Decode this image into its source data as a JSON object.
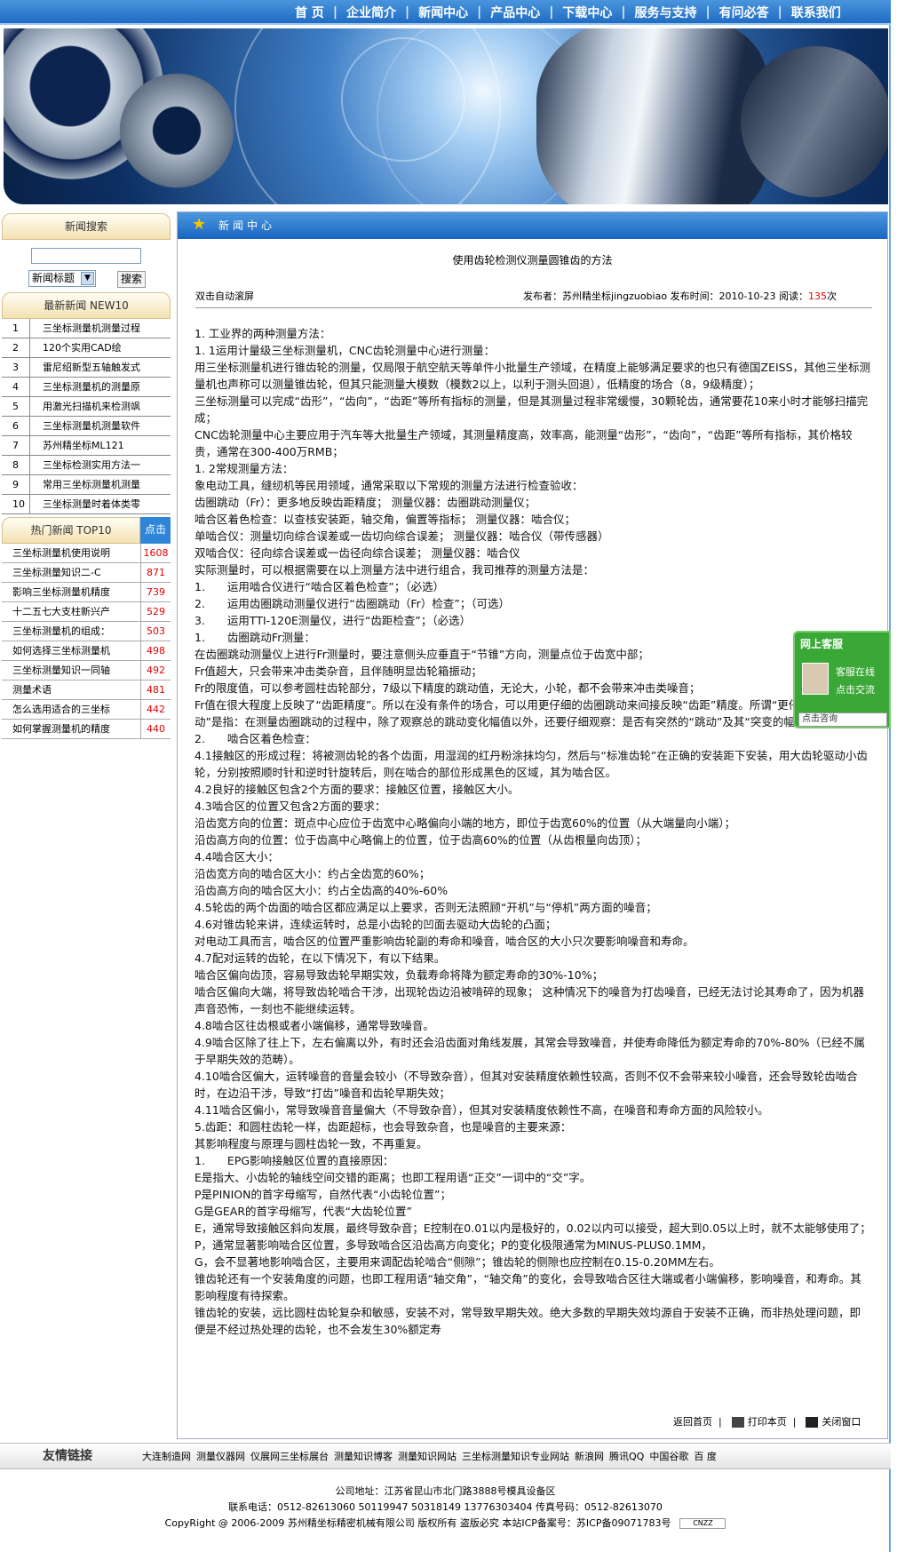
{
  "nav": [
    "首 页",
    "企业简介",
    "新闻中心",
    "产品中心",
    "下载中心",
    "服务与支持",
    "有问必答",
    "联系我们"
  ],
  "search": {
    "head": "新闻搜索",
    "select": "新闻标题",
    "button": "搜索"
  },
  "latest": {
    "head": "最新新闻 NEW10",
    "items": [
      {
        "n": "1",
        "t": "三坐标测量机测量过程"
      },
      {
        "n": "2",
        "t": "120个实用CAD绘"
      },
      {
        "n": "3",
        "t": "雷尼绍新型五轴触发式"
      },
      {
        "n": "4",
        "t": "三坐标测量机的测量原"
      },
      {
        "n": "5",
        "t": "用激光扫描机来检测飒"
      },
      {
        "n": "6",
        "t": "三坐标测量机测量软件"
      },
      {
        "n": "7",
        "t": "苏州精坐标ML121"
      },
      {
        "n": "8",
        "t": "三坐标检测实用方法一"
      },
      {
        "n": "9",
        "t": "常用三坐标测量机测量"
      },
      {
        "n": "10",
        "t": "三坐标测量时着体类零"
      }
    ]
  },
  "hot": {
    "head": "热门新闻 TOP10",
    "click": "点击",
    "items": [
      {
        "t": "三坐标测量机使用说明",
        "c": "1608"
      },
      {
        "t": "三坐标测量知识二-C",
        "c": "871"
      },
      {
        "t": "影响三坐标测量机精度",
        "c": "739"
      },
      {
        "t": "十二五七大支柱新兴产",
        "c": "529"
      },
      {
        "t": "三坐标测量机的组成：",
        "c": "503"
      },
      {
        "t": "如何选择三坐标测量机",
        "c": "498"
      },
      {
        "t": "三坐标测量知识一同轴",
        "c": "492"
      },
      {
        "t": "测量术语",
        "c": "481"
      },
      {
        "t": "怎么选用适合的三坐标",
        "c": "442"
      },
      {
        "t": "如何掌握测量机的精度",
        "c": "440"
      }
    ]
  },
  "main": {
    "head": "新闻中心",
    "title": "使用齿轮检测仪测量圆锥齿的方法",
    "scroll": "双击自动滚屏",
    "meta_pre": "发布者：苏州精坐标jingzuobiao 发布时间：2010-10-23 阅读：",
    "views": "135",
    "meta_post": "次",
    "paragraphs": [
      "1. 工业界的两种测量方法：",
      "1. 1运用计量级三坐标测量机，CNC齿轮测量中心进行测量：",
      "用三坐标测量机进行锥齿轮的测量，仅局限于航空航天等单件小批量生产领域，在精度上能够满足要求的也只有德国ZEISS，其他三坐标测量机也声称可以测量锥齿轮，但其只能测量大模数（模数2以上，以利于测头回退），低精度的场合（8，9级精度）；",
      "三坐标测量可以完成“齿形”，“齿向”，“齿距”等所有指标的测量，但是其测量过程非常缓慢，30颗轮齿，通常要花10来小时才能够扫描完成；",
      "CNC齿轮测量中心主要应用于汽车等大批量生产领域，其测量精度高，效率高，能测量“齿形”，“齿向”，“齿距”等所有指标，其价格较贵，通常在300-400万RMB；",
      "1. 2常规测量方法：",
      "象电动工具，缝纫机等民用领域，通常采取以下常规的测量方法进行检查验收：",
      "齿圈跳动（Fr）：更多地反映齿距精度； 测量仪器：齿圈跳动测量仪；",
      "啮合区着色检查：以查核安装距，轴交角，偏置等指标； 测量仪器：啮合仪；",
      "单啮合仪：测量切向综合误差或一齿切向综合误差； 测量仪器：啮合仪（带传感器）",
      "双啮合仪：径向综合误差或一齿径向综合误差； 测量仪器：啮合仪",
      "实际测量时，可以根据需要在以上测量方法中进行组合，我司推荐的测量方法是：",
      "1.　　运用啮合仪进行“啮合区着色检查”；（必选）",
      "2.　　运用齿圈跳动测量仪进行“齿圈跳动（Fr）检查”；（可选）",
      "3.　　运用TTI-120E测量仪，进行“齿距检查”；（必选）",
      "1.　　齿圈跳动Fr测量：",
      "在齿圈跳动测量仪上进行Fr测量时，要注意侧头应垂直于“节锥”方向，测量点位于齿宽中部；",
      "Fr值超大，只会带来冲击类杂音，且伴随明显齿轮箱振动；",
      "Fr的限度值，可以参考圆柱齿轮部分，7级以下精度的跳动值，无论大，小轮，都不会带来冲击类噪音；",
      "Fr值在很大程度上反映了“齿距精度”。所以在没有条件的场合，可以用更仔细的齿圈跳动来间接反映“齿距”精度。所谓“更仔细的齿圈跳动”是指：在测量齿圈跳动的过程中，除了观察总的跳动变化幅值以外，还要仔细观察：是否有突然的“跳动”及其“突变的幅度”。",
      "2.　　啮合区着色检查：",
      "4.1接触区的形成过程：将被测齿轮的各个齿面，用湿润的红丹粉涂抹均匀，然后与“标准齿轮”在正确的安装距下安装，用大齿轮驱动小齿轮，分别按照顺时针和逆时针旋转后，则在啮合的部位形成黑色的区域，其为啮合区。",
      "4.2良好的接触区包含2个方面的要求：接触区位置，接触区大小。",
      "4.3啮合区的位置又包含2方面的要求：",
      "沿齿宽方向的位置：斑点中心应位于齿宽中心略偏向小端的地方，即位于齿宽60%的位置（从大端量向小端）；",
      "沿齿高方向的位置：位于齿高中心略偏上的位置，位于齿高60%的位置（从齿根量向齿顶）；",
      "4.4啮合区大小：",
      "沿齿宽方向的啮合区大小：约占全齿宽的60%；",
      "沿齿高方向的啮合区大小：约占全齿高的40%-60%",
      "4.5轮齿的两个齿面的啮合区都应满足以上要求，否则无法照顾“开机”与“停机”两方面的噪音；",
      "4.6对锥齿轮来讲，连续运转时，总是小齿轮的凹面去驱动大齿轮的凸面；",
      "对电动工具而言，啮合区的位置严重影响齿轮副的寿命和噪音，啮合区的大小只次要影响噪音和寿命。",
      "4.7配对运转的齿轮，在以下情况下，有以下结果。",
      "啮合区偏向齿顶，容易导致齿轮早期实效，负载寿命将降为额定寿命的30%-10%；",
      "啮合区偏向大端，将导致齿轮啮合干涉，出现轮齿边沿被啃碎的现象； 这种情况下的噪音为打齿噪音，已经无法讨论其寿命了，因为机器声音恐怖，一刻也不能继续运转。",
      "4.8啮合区往齿根或者小端偏移，通常导致噪音。",
      "4.9啮合区除了往上下，左右偏离以外，有时还会沿齿面对角线发展，其常会导致噪音，并使寿命降低为额定寿命的70%-80%（已经不属于早期失效的范畴）。",
      "4.10啮合区偏大，运转噪音的音量会较小（不导致杂音），但其对安装精度依赖性较高，否则不仅不会带来较小噪音，还会导致轮齿啮合时，在边沿干涉，导致“打齿”噪音和齿轮早期失效；",
      "4.11啮合区偏小，常导致噪音音量偏大（不导致杂音），但其对安装精度依赖性不高，在噪音和寿命方面的风险较小。",
      "5.齿距：和圆柱齿轮一样，齿距超标，也会导致杂音，也是噪音的主要来源：",
      "其影响程度与原理与圆柱齿轮一致，不再重复。",
      "1.　　EPG影响接触区位置的直接原因：",
      "E是指大、小齿轮的轴线空间交错的距离；也即工程用语“正交”一词中的“交”字。",
      "P是PINION的首字母缩写，自然代表“小齿轮位置”；",
      "G是GEAR的首字母缩写，代表“大齿轮位置”",
      "E，通常导致接触区斜向发展，最终导致杂音；E控制在0.01以内是极好的，0.02以内可以接受，超大到0.05以上时，就不太能够使用了；",
      "P，通常显著影响啮合区位置，多导致啮合区沿齿高方向变化；P的变化极限通常为MINUS-PLUS0.1MM，",
      "G，会不显著地影响啮合区，主要用来调配齿轮啮合“侧隙”；锥齿轮的侧隙也应控制在0.15-0.20MM左右。",
      "锥齿轮还有一个安装角度的问题，也即工程用语“轴交角”，“轴交角”的变化，会导致啮合区往大端或者小端偏移，影响噪音，和寿命。其影响程度有待探索。",
      "锥齿轮的安装，远比圆柱齿轮复杂和敏感，安装不对，常导致早期失效。绝大多数的早期失效均源自于安装不正确，而非热处理问题，即便是不经过热处理的齿轮，也不会发生30%额定寿"
    ],
    "back": "返回首页",
    "print": "打印本页",
    "close": "关闭窗口"
  },
  "friends": {
    "head": "友情链接",
    "links": [
      "大连制造网",
      "测量仪器网",
      "仪展网三坐标展台",
      "测量知识博客",
      "测量知识网站",
      "三坐标测量知识专业网站",
      "新浪网",
      "腾讯QQ",
      "中国谷歌",
      "百 度"
    ]
  },
  "footer": {
    "addr": "公司地址：江苏省昆山市北门路3888号模具设备区",
    "tel": "联系电话：0512-82613060 50119947 50318149 13776303404 传真号码：0512-82613070",
    "copy": "CopyRight @ 2006-2009 苏州精坐标精密机械有限公司 版权所有 盗版必究 本站ICP备案号：苏ICP备09071783号",
    "badge": "CNZZ"
  },
  "kefu": {
    "title": "网上客服",
    "online": "客服在线",
    "chat": "点击交流",
    "ask": "点击咨询"
  }
}
